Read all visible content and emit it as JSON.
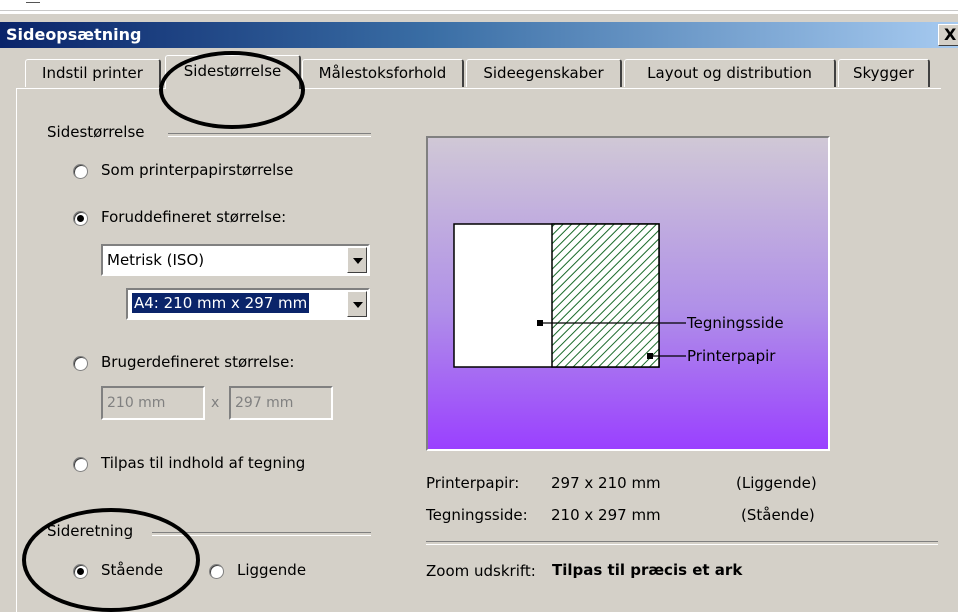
{
  "dialog": {
    "title": "Sideopsætning",
    "close_label": "X"
  },
  "tabs": [
    {
      "label": "Indstil printer",
      "active": false
    },
    {
      "label": "Sidestørrelse",
      "active": true
    },
    {
      "label": "Målestoksforhold",
      "active": false
    },
    {
      "label": "Sideegenskaber",
      "active": false
    },
    {
      "label": "Layout og distribution",
      "active": false
    },
    {
      "label": "Skygger",
      "active": false
    }
  ],
  "page_size": {
    "group_label": "Sidestørrelse",
    "option_printer": "Som printerpapirstørrelse",
    "option_predefined": "Foruddefineret størrelse:",
    "standard_select": "Metrisk (ISO)",
    "size_select": "A4:  210 mm x 297 mm",
    "option_custom": "Brugerdefineret størrelse:",
    "custom_width": "210 mm",
    "custom_times": "x",
    "custom_height": "297 mm",
    "option_fit": "Tilpas til indhold af tegning",
    "selected": "predefined"
  },
  "orientation": {
    "group_label": "Sideretning",
    "option_portrait": "Stående",
    "option_landscape": "Liggende",
    "selected": "portrait"
  },
  "preview": {
    "drawing_page_label": "Tegningsside",
    "printer_paper_label": "Printerpapir"
  },
  "info": {
    "paper_label": "Printerpapir:",
    "paper_size": "297 x 210 mm",
    "paper_orientation": "(Liggende)",
    "drawing_label": "Tegningsside:",
    "drawing_size": "210 x 297 mm",
    "drawing_orientation": "(Stående)",
    "zoom_label": "Zoom udskrift:",
    "zoom_value": "Tilpas til præcis et ark"
  },
  "colors": {
    "titlebar_start": "#0a246a",
    "titlebar_end": "#a6caf0",
    "dialog_face": "#d4d0c8",
    "preview_top": "#d0c8d6",
    "preview_bottom": "#9a40ff",
    "hatch": "#1a6a2a"
  }
}
